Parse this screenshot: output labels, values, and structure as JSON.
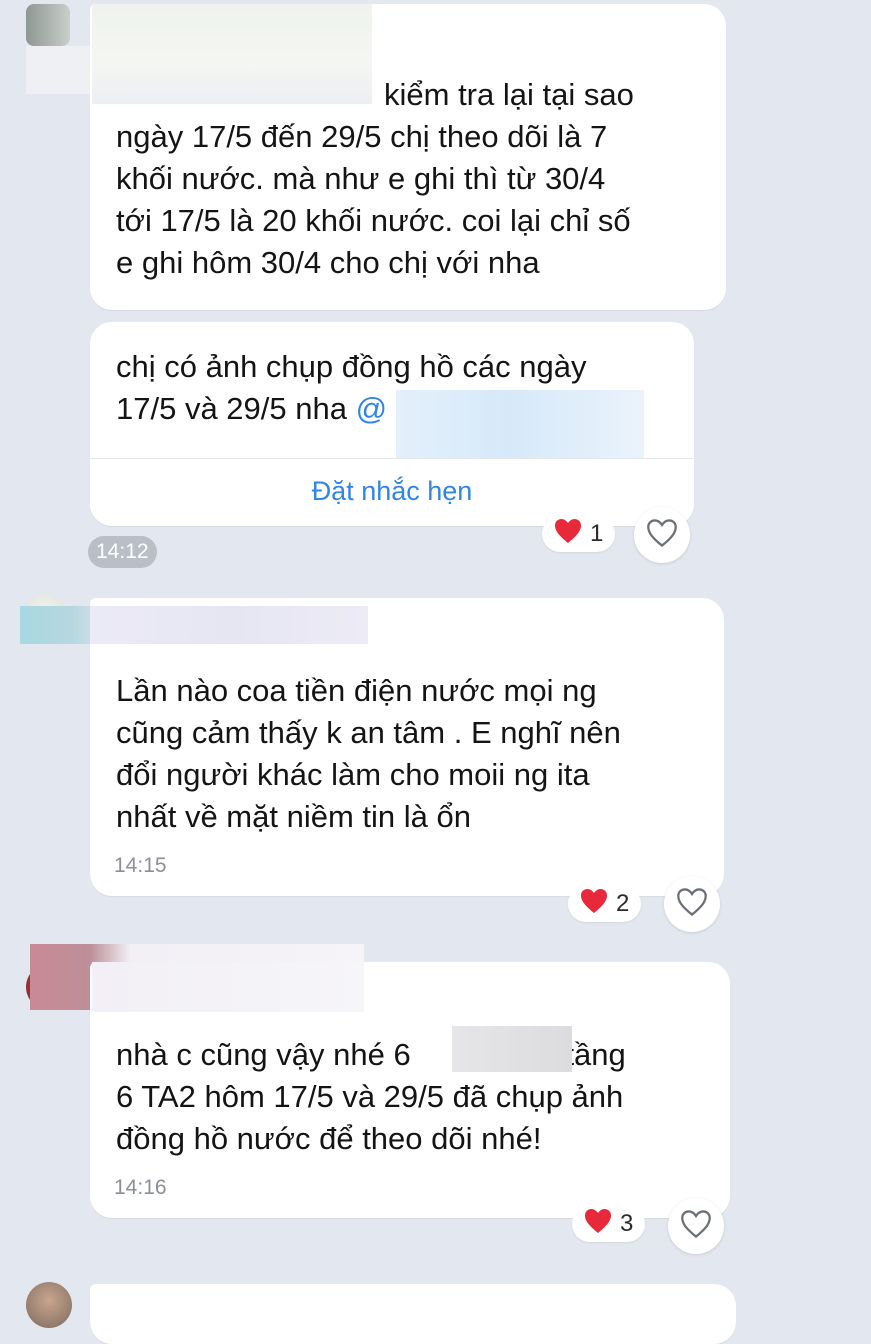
{
  "messages": [
    {
      "lines": [
        "kiểm tra lại tại sao",
        "ngày 17/5 đến 29/5 chị theo dõi là 7",
        "khối nước. mà như e ghi thì từ 30/4",
        "tới 17/5 là 20 khối nước. coi lại chỉ số",
        "e ghi hôm 30/4 cho chị với nha"
      ]
    },
    {
      "lines": [
        "chị có ảnh chụp đồng hồ các ngày",
        "17/5 và 29/5 nha"
      ],
      "mention_prefix": "@",
      "action_label": "Đặt nhắc hẹn",
      "reaction_count": "1",
      "time": "14:12"
    },
    {
      "lines": [
        "Lần nào coa tiền điện nước mọi ng",
        "cũng cảm thấy k an tâm . E nghĩ nên",
        "đổi người khác làm cho moii ng ita",
        "nhất về mặt niềm tin là ổn"
      ],
      "time": "14:15",
      "reaction_count": "2"
    },
    {
      "lines_first_a": "nhà c cũng vậy nhé 6",
      "lines_first_b": "vì tầng",
      "lines": [
        "6 TA2 hôm 17/5 và 29/5 đã chụp ảnh",
        "đồng hồ nước để  theo dõi nhé!"
      ],
      "time": "14:16",
      "reaction_count": "3"
    }
  ],
  "icons": {
    "reaction": "red-heart-icon",
    "like": "heart-outline-icon"
  },
  "colors": {
    "background": "#e3e8f0",
    "bubble": "#ffffff",
    "link": "#2f86e8",
    "heart": "#e8293b"
  }
}
